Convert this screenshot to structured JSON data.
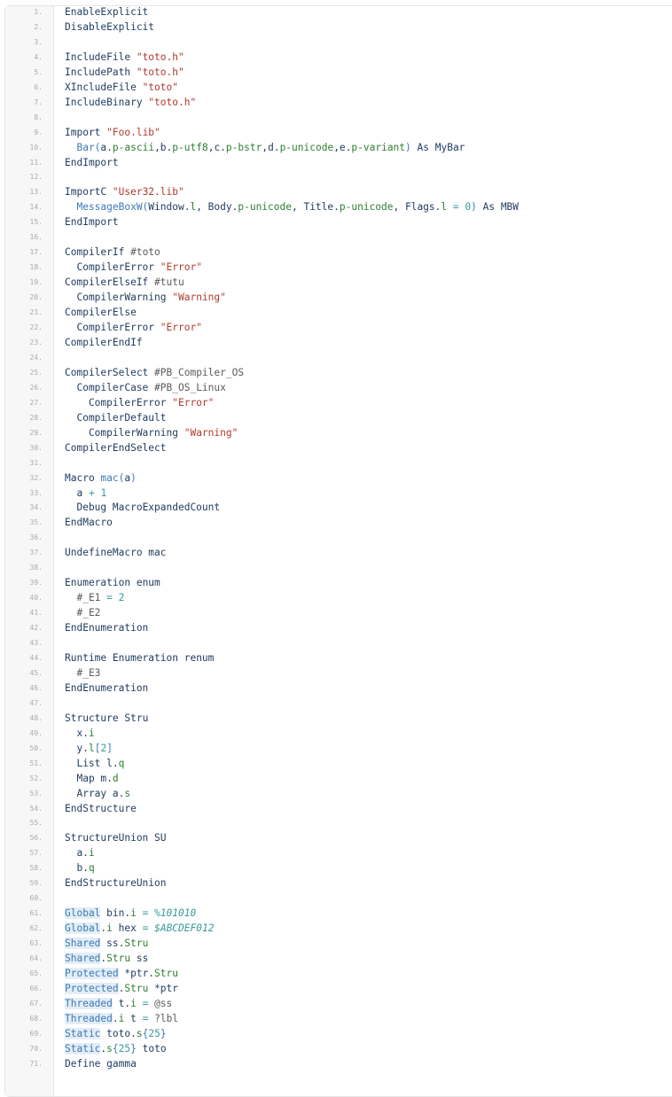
{
  "code_lines": [
    {
      "n": "1.",
      "t": [
        [
          "kw",
          "EnableExplicit"
        ]
      ]
    },
    {
      "n": "2.",
      "t": [
        [
          "kw",
          "DisableExplicit"
        ]
      ]
    },
    {
      "n": "3.",
      "t": []
    },
    {
      "n": "4.",
      "t": [
        [
          "kw",
          "IncludeFile "
        ],
        [
          "str",
          "\"toto.h\""
        ]
      ]
    },
    {
      "n": "5.",
      "t": [
        [
          "kw",
          "IncludePath "
        ],
        [
          "str",
          "\"toto.h\""
        ]
      ]
    },
    {
      "n": "6.",
      "t": [
        [
          "kw",
          "XIncludeFile "
        ],
        [
          "str",
          "\"toto\""
        ]
      ]
    },
    {
      "n": "7.",
      "t": [
        [
          "kw",
          "IncludeBinary "
        ],
        [
          "str",
          "\"toto.h\""
        ]
      ]
    },
    {
      "n": "8.",
      "t": []
    },
    {
      "n": "9.",
      "t": [
        [
          "kw",
          "Import "
        ],
        [
          "str",
          "\"Foo.lib\""
        ]
      ]
    },
    {
      "n": "10.",
      "t": [
        [
          "fn",
          "  Bar("
        ],
        [
          "id",
          "a."
        ],
        [
          "ty",
          "p-ascii"
        ],
        [
          "id",
          ",b."
        ],
        [
          "ty",
          "p-utf8"
        ],
        [
          "id",
          ",c."
        ],
        [
          "ty",
          "p-bstr"
        ],
        [
          "id",
          ",d."
        ],
        [
          "ty",
          "p-unicode"
        ],
        [
          "id",
          ",e."
        ],
        [
          "ty",
          "p-variant"
        ],
        [
          "fn",
          ") "
        ],
        [
          "kw",
          "As "
        ],
        [
          "id",
          "MyBar"
        ]
      ]
    },
    {
      "n": "11.",
      "t": [
        [
          "kw",
          "EndImport"
        ]
      ]
    },
    {
      "n": "12.",
      "t": []
    },
    {
      "n": "13.",
      "t": [
        [
          "kw",
          "ImportC "
        ],
        [
          "str",
          "\"User32.lib\""
        ]
      ]
    },
    {
      "n": "14.",
      "t": [
        [
          "fn",
          "  MessageBoxW("
        ],
        [
          "id",
          "Window."
        ],
        [
          "ty",
          "l"
        ],
        [
          "id",
          ", Body."
        ],
        [
          "ty",
          "p-unicode"
        ],
        [
          "id",
          ", Title."
        ],
        [
          "ty",
          "p-unicode"
        ],
        [
          "id",
          ", Flags."
        ],
        [
          "ty",
          "l"
        ],
        [
          "op",
          " = "
        ],
        [
          "num",
          "0"
        ],
        [
          "fn",
          ") "
        ],
        [
          "kw",
          "As "
        ],
        [
          "id",
          "MBW"
        ]
      ]
    },
    {
      "n": "15.",
      "t": [
        [
          "kw",
          "EndImport"
        ]
      ]
    },
    {
      "n": "16.",
      "t": []
    },
    {
      "n": "17.",
      "t": [
        [
          "kw",
          "CompilerIf "
        ],
        [
          "cst",
          "#toto"
        ]
      ]
    },
    {
      "n": "18.",
      "t": [
        [
          "kw",
          "  CompilerError "
        ],
        [
          "str",
          "\"Error\""
        ]
      ]
    },
    {
      "n": "19.",
      "t": [
        [
          "kw",
          "CompilerElseIf "
        ],
        [
          "cst",
          "#tutu"
        ]
      ]
    },
    {
      "n": "20.",
      "t": [
        [
          "kw",
          "  CompilerWarning "
        ],
        [
          "str",
          "\"Warning\""
        ]
      ]
    },
    {
      "n": "21.",
      "t": [
        [
          "kw",
          "CompilerElse"
        ]
      ]
    },
    {
      "n": "22.",
      "t": [
        [
          "kw",
          "  CompilerError "
        ],
        [
          "str",
          "\"Error\""
        ]
      ]
    },
    {
      "n": "23.",
      "t": [
        [
          "kw",
          "CompilerEndIf"
        ]
      ]
    },
    {
      "n": "24.",
      "t": []
    },
    {
      "n": "25.",
      "t": [
        [
          "kw",
          "CompilerSelect "
        ],
        [
          "cst",
          "#PB_Compiler_OS"
        ]
      ]
    },
    {
      "n": "26.",
      "t": [
        [
          "kw",
          "  CompilerCase "
        ],
        [
          "cst",
          "#PB_OS_Linux"
        ]
      ]
    },
    {
      "n": "27.",
      "t": [
        [
          "kw",
          "    CompilerError "
        ],
        [
          "str",
          "\"Error\""
        ]
      ]
    },
    {
      "n": "28.",
      "t": [
        [
          "kw",
          "  CompilerDefault"
        ]
      ]
    },
    {
      "n": "29.",
      "t": [
        [
          "kw",
          "    CompilerWarning "
        ],
        [
          "str",
          "\"Warning\""
        ]
      ]
    },
    {
      "n": "30.",
      "t": [
        [
          "kw",
          "CompilerEndSelect"
        ]
      ]
    },
    {
      "n": "31.",
      "t": []
    },
    {
      "n": "32.",
      "t": [
        [
          "kw",
          "Macro "
        ],
        [
          "fn",
          "mac("
        ],
        [
          "id",
          "a"
        ],
        [
          "fn",
          ")"
        ]
      ]
    },
    {
      "n": "33.",
      "t": [
        [
          "id",
          "  a "
        ],
        [
          "op",
          "+ "
        ],
        [
          "num",
          "1"
        ]
      ]
    },
    {
      "n": "34.",
      "t": [
        [
          "kw",
          "  Debug "
        ],
        [
          "id",
          "MacroExpandedCount"
        ]
      ]
    },
    {
      "n": "35.",
      "t": [
        [
          "kw",
          "EndMacro"
        ]
      ]
    },
    {
      "n": "36.",
      "t": []
    },
    {
      "n": "37.",
      "t": [
        [
          "kw",
          "UndefineMacro "
        ],
        [
          "id",
          "mac"
        ]
      ]
    },
    {
      "n": "38.",
      "t": []
    },
    {
      "n": "39.",
      "t": [
        [
          "kw",
          "Enumeration "
        ],
        [
          "id",
          "enum"
        ]
      ]
    },
    {
      "n": "40.",
      "t": [
        [
          "cst",
          "  #_E1 "
        ],
        [
          "op",
          "= "
        ],
        [
          "num",
          "2"
        ]
      ]
    },
    {
      "n": "41.",
      "t": [
        [
          "cst",
          "  #_E2"
        ]
      ]
    },
    {
      "n": "42.",
      "t": [
        [
          "kw",
          "EndEnumeration"
        ]
      ]
    },
    {
      "n": "43.",
      "t": []
    },
    {
      "n": "44.",
      "t": [
        [
          "kw",
          "Runtime Enumeration "
        ],
        [
          "id",
          "renum"
        ]
      ]
    },
    {
      "n": "45.",
      "t": [
        [
          "cst",
          "  #_E3"
        ]
      ]
    },
    {
      "n": "46.",
      "t": [
        [
          "kw",
          "EndEnumeration"
        ]
      ]
    },
    {
      "n": "47.",
      "t": []
    },
    {
      "n": "48.",
      "t": [
        [
          "kw",
          "Structure "
        ],
        [
          "id",
          "Stru"
        ]
      ]
    },
    {
      "n": "49.",
      "t": [
        [
          "id",
          "  x."
        ],
        [
          "ty",
          "i"
        ]
      ]
    },
    {
      "n": "50.",
      "t": [
        [
          "id",
          "  y."
        ],
        [
          "ty",
          "l"
        ],
        [
          "fn",
          "["
        ],
        [
          "num",
          "2"
        ],
        [
          "fn",
          "]"
        ]
      ]
    },
    {
      "n": "51.",
      "t": [
        [
          "kw",
          "  List "
        ],
        [
          "id",
          "l."
        ],
        [
          "ty",
          "q"
        ]
      ]
    },
    {
      "n": "52.",
      "t": [
        [
          "kw",
          "  Map "
        ],
        [
          "id",
          "m."
        ],
        [
          "ty",
          "d"
        ]
      ]
    },
    {
      "n": "53.",
      "t": [
        [
          "kw",
          "  Array "
        ],
        [
          "id",
          "a."
        ],
        [
          "ty",
          "s"
        ]
      ]
    },
    {
      "n": "54.",
      "t": [
        [
          "kw",
          "EndStructure"
        ]
      ]
    },
    {
      "n": "55.",
      "t": []
    },
    {
      "n": "56.",
      "t": [
        [
          "kw",
          "StructureUnion "
        ],
        [
          "id",
          "SU"
        ]
      ]
    },
    {
      "n": "57.",
      "t": [
        [
          "id",
          "  a."
        ],
        [
          "ty",
          "i"
        ]
      ]
    },
    {
      "n": "58.",
      "t": [
        [
          "id",
          "  b."
        ],
        [
          "ty",
          "q"
        ]
      ]
    },
    {
      "n": "59.",
      "t": [
        [
          "kw",
          "EndStructureUnion"
        ]
      ]
    },
    {
      "n": "60.",
      "t": []
    },
    {
      "n": "61.",
      "t": [
        [
          "sc",
          "Global"
        ],
        [
          "id",
          " bin."
        ],
        [
          "ty",
          "i"
        ],
        [
          "op",
          " = "
        ],
        [
          "hex",
          "%101010"
        ]
      ]
    },
    {
      "n": "62.",
      "t": [
        [
          "sc",
          "Global"
        ],
        [
          "id",
          "."
        ],
        [
          "ty",
          "i"
        ],
        [
          "id",
          " hex "
        ],
        [
          "op",
          "= "
        ],
        [
          "hex",
          "$ABCDEF012"
        ]
      ]
    },
    {
      "n": "63.",
      "t": [
        [
          "sc",
          "Shared"
        ],
        [
          "id",
          " ss."
        ],
        [
          "ty",
          "Stru"
        ]
      ]
    },
    {
      "n": "64.",
      "t": [
        [
          "sc",
          "Shared"
        ],
        [
          "id",
          "."
        ],
        [
          "ty",
          "Stru"
        ],
        [
          "id",
          " ss"
        ]
      ]
    },
    {
      "n": "65.",
      "t": [
        [
          "sc",
          "Protected"
        ],
        [
          "id",
          " *ptr."
        ],
        [
          "ty",
          "Stru"
        ]
      ]
    },
    {
      "n": "66.",
      "t": [
        [
          "sc",
          "Protected"
        ],
        [
          "id",
          "."
        ],
        [
          "ty",
          "Stru"
        ],
        [
          "id",
          " *ptr"
        ]
      ]
    },
    {
      "n": "67.",
      "t": [
        [
          "sc",
          "Threaded"
        ],
        [
          "id",
          " t."
        ],
        [
          "ty",
          "i"
        ],
        [
          "op",
          " = "
        ],
        [
          "cst",
          "@ss"
        ]
      ]
    },
    {
      "n": "68.",
      "t": [
        [
          "sc",
          "Threaded"
        ],
        [
          "id",
          "."
        ],
        [
          "ty",
          "i"
        ],
        [
          "id",
          " t "
        ],
        [
          "op",
          "= "
        ],
        [
          "cst",
          "?lbl"
        ]
      ]
    },
    {
      "n": "69.",
      "t": [
        [
          "sc",
          "Static"
        ],
        [
          "id",
          " toto."
        ],
        [
          "ty",
          "s"
        ],
        [
          "fn",
          "{"
        ],
        [
          "num",
          "25"
        ],
        [
          "fn",
          "}"
        ]
      ]
    },
    {
      "n": "70.",
      "t": [
        [
          "sc",
          "Static"
        ],
        [
          "id",
          "."
        ],
        [
          "ty",
          "s"
        ],
        [
          "fn",
          "{"
        ],
        [
          "num",
          "25"
        ],
        [
          "fn",
          "}"
        ],
        [
          "id",
          " toto"
        ]
      ]
    },
    {
      "n": "71.",
      "t": [
        [
          "kw",
          "Define "
        ],
        [
          "id",
          "gamma"
        ]
      ]
    }
  ]
}
